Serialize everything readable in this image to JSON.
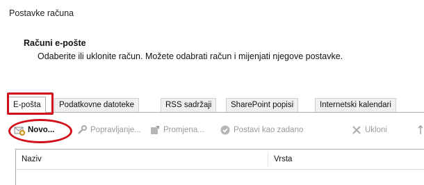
{
  "dialog": {
    "title": "Postavke računa"
  },
  "section": {
    "heading": "Računi e-pošte",
    "description": "Odaberite ili uklonite račun. Možete odabrati račun i mijenjati njegove postavke."
  },
  "tabs": [
    {
      "label": "E-pošta",
      "active": true
    },
    {
      "label": "Podatkovne datoteke",
      "active": false
    },
    {
      "label": "RSS sadržaji",
      "active": false
    },
    {
      "label": "SharePoint popisi",
      "active": false
    },
    {
      "label": "Internetski kalendari",
      "active": false
    }
  ],
  "toolbar": {
    "new_label": "Novo...",
    "repair_label": "Popravljanje...",
    "change_label": "Promjena...",
    "set_default_label": "Postavi kao zadano",
    "remove_label": "Ukloni"
  },
  "list": {
    "columns": [
      "Naziv",
      "Vrsta"
    ]
  },
  "colors": {
    "annotation": "#d10f1a",
    "accent": "#2f7ed8"
  }
}
